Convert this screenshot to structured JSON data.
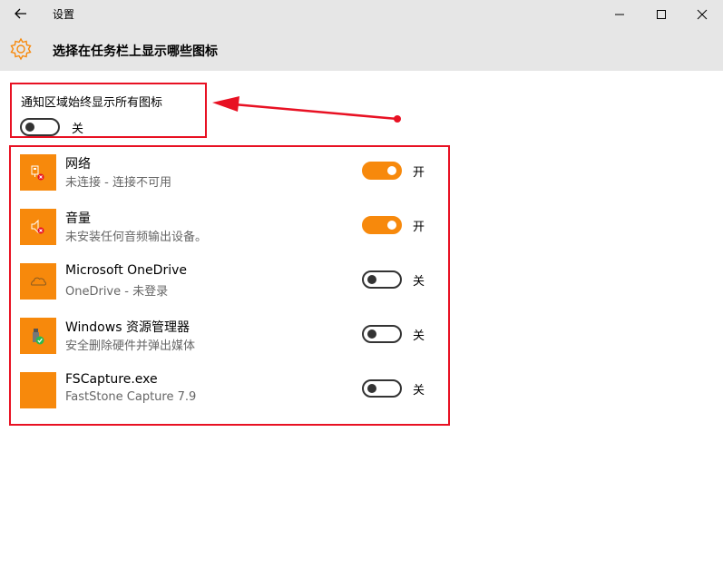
{
  "window": {
    "title": "设置",
    "back_icon": "arrow-left-icon",
    "controls": [
      "minimize-icon",
      "maximize-icon",
      "close-icon"
    ]
  },
  "header": {
    "icon": "gear-icon",
    "title": "选择在任务栏上显示哪些图标"
  },
  "always_show": {
    "label": "通知区域始终显示所有图标",
    "state": "关",
    "on": false
  },
  "items": [
    {
      "name": "网络",
      "description": "未连接 - 连接不可用",
      "state": "开",
      "on": true,
      "icon": "network-error-icon"
    },
    {
      "name": "音量",
      "description": "未安装任何音频输出设备。",
      "state": "开",
      "on": true,
      "icon": "volume-error-icon"
    },
    {
      "name": "Microsoft OneDrive",
      "description": "OneDrive - 未登录",
      "state": "关",
      "on": false,
      "icon": "onedrive-cloud-icon"
    },
    {
      "name": "Windows 资源管理器",
      "description": "安全删除硬件并弹出媒体",
      "state": "关",
      "on": false,
      "icon": "usb-eject-icon"
    },
    {
      "name": "FSCapture.exe",
      "description": "FastStone Capture 7.9",
      "state": "关",
      "on": false,
      "icon": "blank-app-icon"
    }
  ],
  "colors": {
    "accent": "#f7890c",
    "highlight_border": "#e81123",
    "arrow": "#e81123",
    "chrome": "#e6e6e6"
  }
}
